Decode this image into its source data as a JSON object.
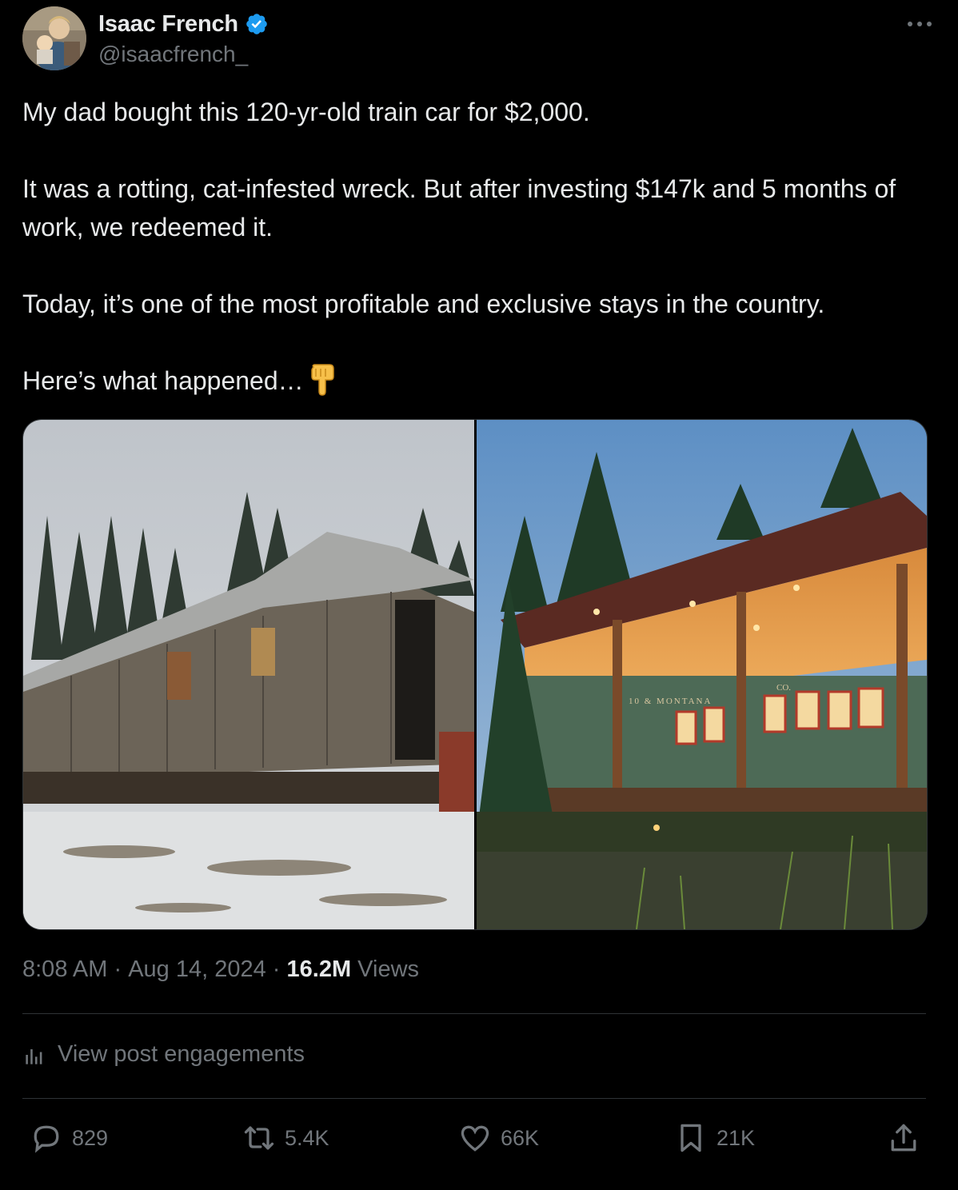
{
  "author": {
    "display_name": "Isaac French",
    "handle": "@isaacfrench_",
    "verified_icon": "verified-badge-icon",
    "avatar_icon": "avatar"
  },
  "menu_icon": "more-options-icon",
  "tweet": {
    "paragraphs": [
      "My dad bought this 120-yr-old train car for $2,000.",
      "It was a rotting, cat-infested wreck. But after investing $147k and 5 months of work, we redeemed it.",
      "Today, it’s one of the most profitable and exclusive stays in the country.",
      "Here’s what happened…"
    ],
    "trailing_emoji": "pointing-down-emoji"
  },
  "media": {
    "left_image": "abandoned-train-car-photo",
    "right_image": "restored-train-car-photo",
    "right_image_sign_text": "10 & MONTANA",
    "right_image_sign_text_2": "CO."
  },
  "meta": {
    "time": "8:08 AM",
    "separator": " · ",
    "date": "Aug 14, 2024",
    "views_count": "16.2M",
    "views_label": " Views"
  },
  "engagements": {
    "label": "View post engagements",
    "icon": "bar-chart-icon"
  },
  "actions": {
    "replies": {
      "count": "829",
      "icon": "reply-icon"
    },
    "reposts": {
      "count": "5.4K",
      "icon": "repost-icon"
    },
    "likes": {
      "count": "66K",
      "icon": "like-icon"
    },
    "bookmarks": {
      "count": "21K",
      "icon": "bookmark-icon"
    },
    "share": {
      "icon": "share-icon"
    }
  },
  "colors": {
    "background": "#000000",
    "text_primary": "#e7e9ea",
    "text_secondary": "#71767b",
    "verified_blue": "#1d9bf0",
    "divider": "#2f3336"
  }
}
